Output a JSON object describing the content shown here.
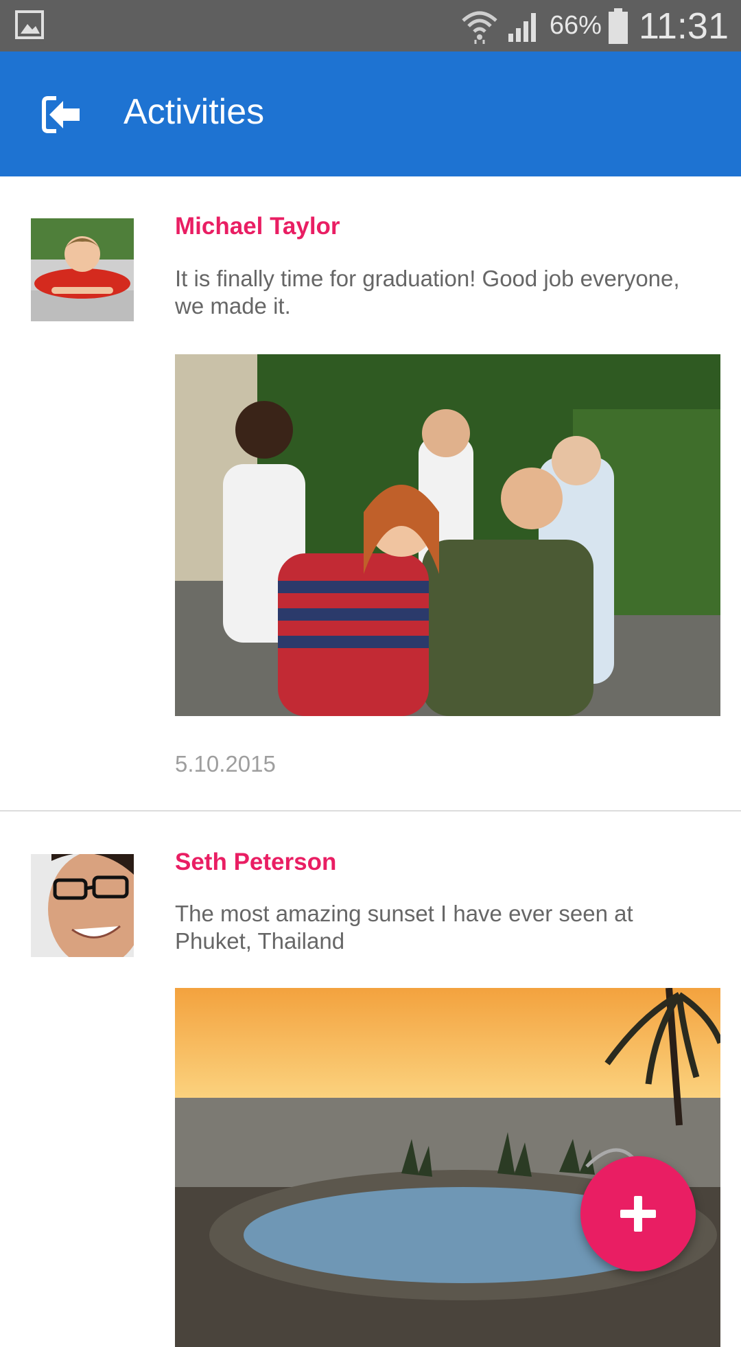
{
  "status_bar": {
    "battery_percent": "66%",
    "time": "11:31"
  },
  "app_bar": {
    "title": "Activities",
    "back_icon": "exit-arrow-icon"
  },
  "posts": [
    {
      "author": "Michael Taylor",
      "text": "It is finally time for graduation! Good job everyone, we made it.",
      "date": "5.10.2015"
    },
    {
      "author": "Seth Peterson",
      "text": "The most amazing sunset I have ever seen at Phuket, Thailand"
    }
  ],
  "fab": {
    "icon": "plus-icon"
  },
  "colors": {
    "primary": "#1e73d2",
    "accent": "#e91e63",
    "status_bar": "#5f5f5f"
  }
}
